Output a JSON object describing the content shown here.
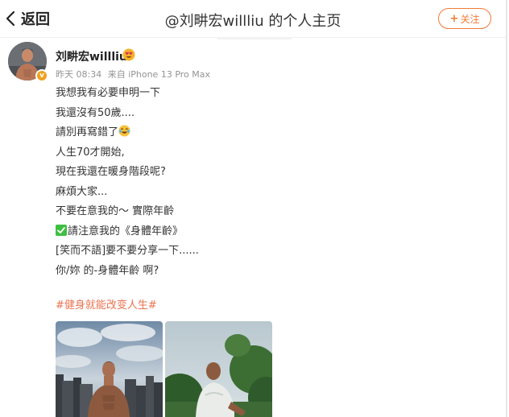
{
  "header": {
    "back_label": "返回",
    "title": "@刘畊宏willliu 的个人主页",
    "follow_label": "关注",
    "follow_plus": "+"
  },
  "post": {
    "username": "刘畊宏willliu",
    "verify_badge": "v",
    "time": "昨天 08:34",
    "source": "来自 iPhone 13 Pro Max",
    "lines": [
      "我想我有必要申明一下",
      "我還沒有50歲....",
      "請別再寫錯了",
      "人生70才開始,",
      "現在我還在暖身階段呢?",
      "麻煩大家...",
      "不要在意我的～ 實際年齡",
      "請注意我的《身體年齡》",
      "[笑而不語]要不要分享一下......",
      "你/妳 的-身體年齡 啊?"
    ],
    "hashtag": "#健身就能改变人生#"
  },
  "colors": {
    "accent": "#f07a36",
    "hashtag": "#eb7350",
    "check_emoji": "#3fbf42",
    "text": "#333333",
    "meta": "#939393"
  },
  "icons": {
    "back": "chevron-left-icon",
    "user_emoji": "heart-eyes-emoji-icon",
    "line3_emoji": "laugh-crying-emoji-icon",
    "line8_emoji": "check-mark-emoji-icon"
  }
}
